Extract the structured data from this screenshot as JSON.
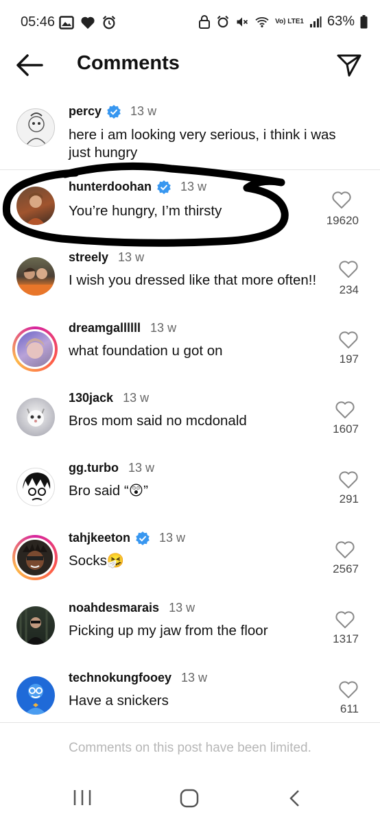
{
  "status_bar": {
    "time": "05:46",
    "battery": "63%",
    "network": "Vo) LTE1"
  },
  "header": {
    "title": "Comments"
  },
  "comments": [
    {
      "user": "percy",
      "verified": true,
      "time": "13 w",
      "text": "here i am looking very serious, i think i was just hungry",
      "likes": ""
    },
    {
      "user": "hunterdoohan",
      "verified": true,
      "time": "13 w",
      "text": "You’re hungry, I’m thirsty",
      "likes": "19620"
    },
    {
      "user": "streely",
      "verified": false,
      "time": "13 w",
      "text": "I wish you dressed like that more often!!",
      "likes": "234"
    },
    {
      "user": "dreamgallllll",
      "verified": false,
      "time": "13 w",
      "text": "what foundation u got on",
      "likes": "197"
    },
    {
      "user": "130jack",
      "verified": false,
      "time": "13 w",
      "text": "Bros mom said no mcdonald",
      "likes": "1607"
    },
    {
      "user": "gg.turbo",
      "verified": false,
      "time": "13 w",
      "text": "Bro said “😲”",
      "likes": "291"
    },
    {
      "user": "tahjkeeton",
      "verified": true,
      "time": "13 w",
      "text": "Socks🤧",
      "likes": "2567"
    },
    {
      "user": "noahdesmarais",
      "verified": false,
      "time": "13 w",
      "text": "Picking up my jaw from the floor",
      "likes": "1317"
    },
    {
      "user": "technokungfooey",
      "verified": false,
      "time": "13 w",
      "text": "Have a snickers",
      "likes": "611"
    }
  ],
  "footer": {
    "limited_text": "Comments on this post have been limited."
  },
  "colors": {
    "verified_blue": "#3897f0",
    "muted_text": "#b7b7b7"
  },
  "icons": [
    "back-arrow-icon",
    "send-icon",
    "heart-icon",
    "verified-badge-icon",
    "recent-apps-icon",
    "home-icon",
    "back-nav-icon"
  ]
}
